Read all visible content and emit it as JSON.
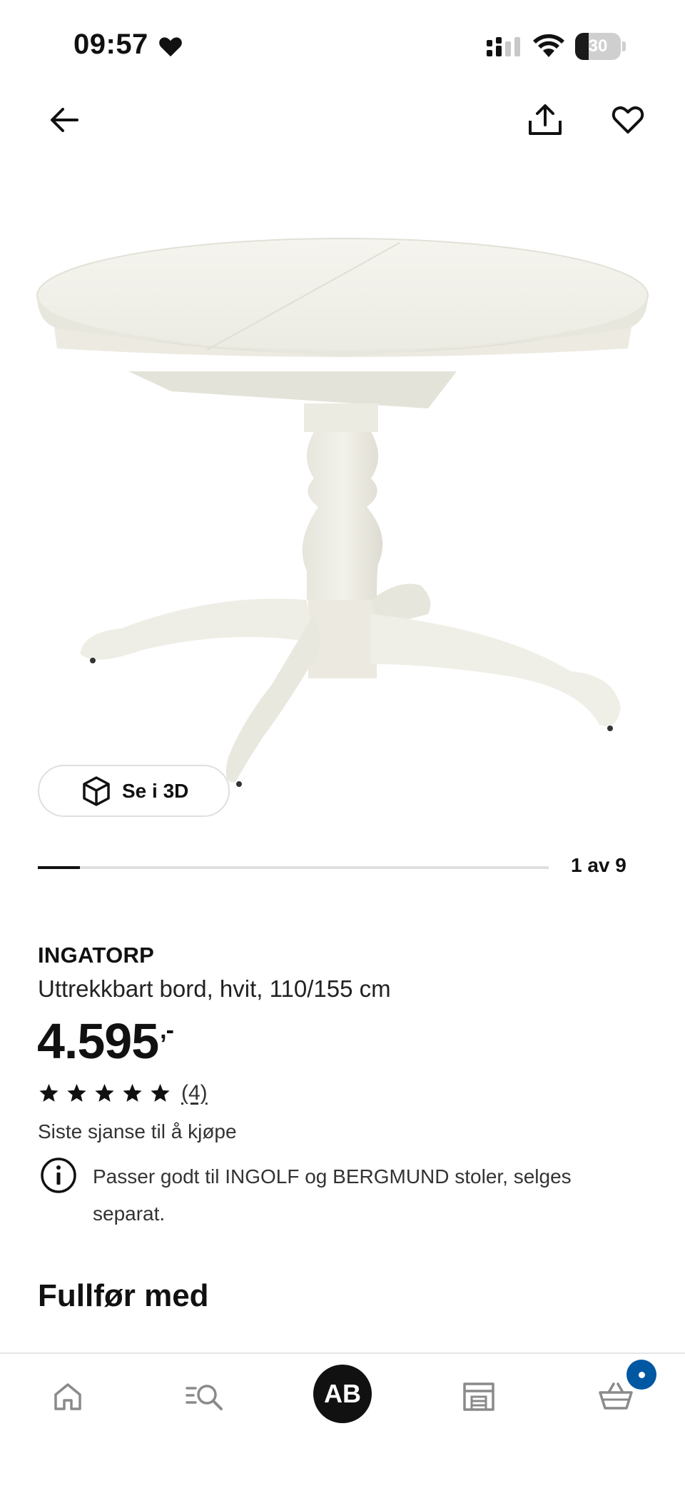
{
  "status_bar": {
    "time": "09:57",
    "battery_level": "30",
    "battery_fraction": 0.3
  },
  "top_nav": {
    "icons": [
      "back-arrow-icon",
      "share-icon",
      "heart-icon"
    ]
  },
  "product_image": {
    "view_3d_label": "Se i 3D",
    "carousel_counter": "1 av 9",
    "carousel_progress": 0.083
  },
  "product": {
    "name": "INGATORP",
    "description": "Uttrekkbart bord, hvit, 110/155 cm",
    "price": "4.595",
    "price_suffix": ",-",
    "rating": 5,
    "review_count": "(4)",
    "availability": "Siste sjanse til å kjøpe",
    "info_note": "Passer godt til INGOLF og BERGMUND stoler, selges separat."
  },
  "section": {
    "title": "Fullfør med"
  },
  "bottom_nav": {
    "avatar_initials": "AB",
    "items": [
      "home-icon",
      "search-icon",
      "store-icon",
      "cart-icon"
    ],
    "accent_color": "#0058a3"
  }
}
